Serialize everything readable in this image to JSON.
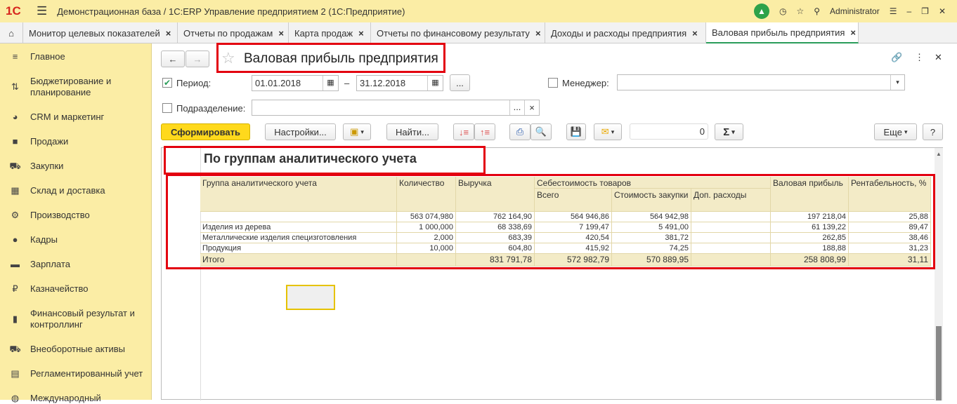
{
  "app": {
    "logo": "1С",
    "title": "Демонстрационная база / 1С:ERP Управление предприятием 2  (1С:Предприятие)",
    "user": "Administrator"
  },
  "tabs": [
    {
      "label": "Монитор целевых показателей"
    },
    {
      "label": "Отчеты по продажам"
    },
    {
      "label": "Карта продаж"
    },
    {
      "label": "Отчеты по финансовому результату"
    },
    {
      "label": "Доходы и расходы предприятия"
    },
    {
      "label": "Валовая прибыль предприятия",
      "active": true
    }
  ],
  "sidebar": {
    "items": [
      {
        "label": "Главное"
      },
      {
        "label": "Бюджетирование и планирование"
      },
      {
        "label": "CRM и маркетинг"
      },
      {
        "label": "Продажи"
      },
      {
        "label": "Закупки"
      },
      {
        "label": "Склад и доставка"
      },
      {
        "label": "Производство"
      },
      {
        "label": "Кадры"
      },
      {
        "label": "Зарплата"
      },
      {
        "label": "Казначейство"
      },
      {
        "label": "Финансовый результат и контроллинг"
      },
      {
        "label": "Внеоборотные активы"
      },
      {
        "label": "Регламентированный учет"
      },
      {
        "label": "Международный"
      }
    ]
  },
  "form": {
    "title": "Валовая прибыль предприятия",
    "period_label": "Период:",
    "date_from": "01.01.2018",
    "dash": "–",
    "date_to": "31.12.2018",
    "ellipsis": "...",
    "manager_label": "Менеджер:",
    "manager_value": "",
    "division_label": "Подразделение:",
    "division_value": "",
    "clear": "×"
  },
  "toolbar": {
    "generate": "Сформировать",
    "settings": "Настройки...",
    "find": "Найти...",
    "sum_value": "0",
    "more": "Еще",
    "help": "?"
  },
  "report": {
    "title": "По группам аналитического учета",
    "headers": {
      "group": "Группа аналитического учета",
      "qty": "Количество",
      "revenue": "Выручка",
      "cost": "Себестоимость товаров",
      "cost_total": "Всего",
      "cost_purchase": "Стоимость закупки",
      "cost_extra": "Доп. расходы",
      "gross": "Валовая прибыль",
      "margin": "Рентабельность, %"
    },
    "rows": [
      [
        "",
        "563 074,980",
        "762 164,90",
        "564 946,86",
        "564 942,98",
        "",
        "197 218,04",
        "25,88"
      ],
      [
        "Изделия из дерева",
        "1 000,000",
        "68 338,69",
        "7 199,47",
        "5 491,00",
        "",
        "61 139,22",
        "89,47"
      ],
      [
        "Металлические изделия специзготовления",
        "2,000",
        "683,39",
        "420,54",
        "381,72",
        "",
        "262,85",
        "38,46"
      ],
      [
        "Продукция",
        "10,000",
        "604,80",
        "415,92",
        "74,25",
        "",
        "188,88",
        "31,23"
      ]
    ],
    "total": [
      "Итого",
      "",
      "831 791,78",
      "572 982,79",
      "570 889,95",
      "",
      "258 808,99",
      "31,11"
    ]
  }
}
